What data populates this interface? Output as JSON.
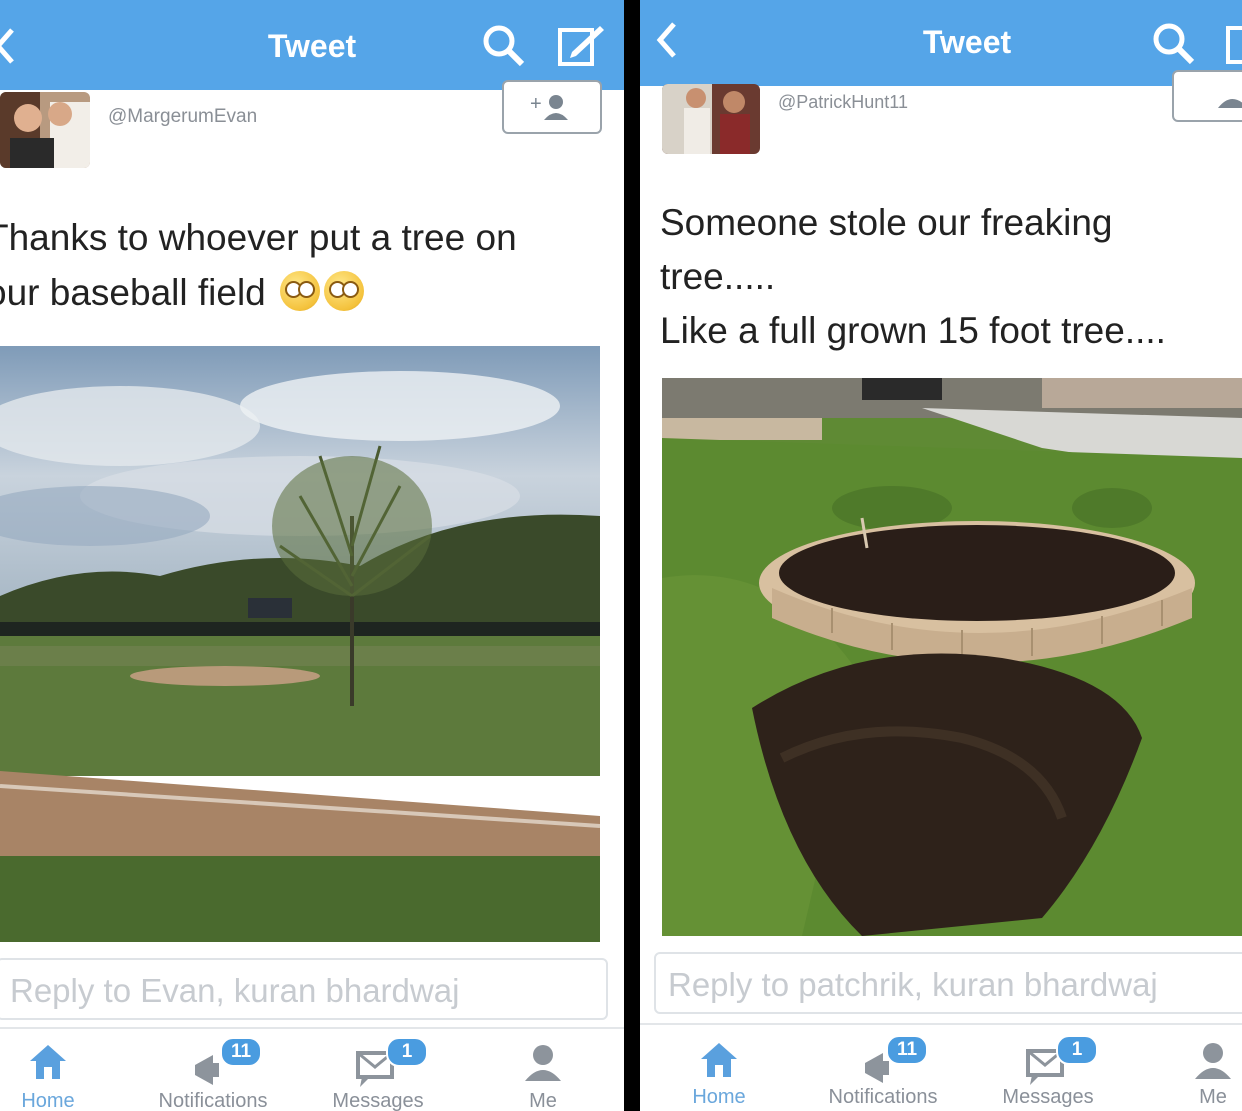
{
  "left": {
    "header": {
      "title": "Tweet"
    },
    "tweet": {
      "handle": "@MargerumEvan",
      "text_lines": [
        "Thanks to whoever put a tree on",
        "our baseball field"
      ]
    },
    "reply": {
      "placeholder": "Reply to Evan, kuran bhardwaj"
    },
    "tabbar": {
      "home": "Home",
      "notifications": "Notifications",
      "notifications_badge": "11",
      "messages": "Messages",
      "messages_badge": "1",
      "me": "Me"
    }
  },
  "right": {
    "header": {
      "title": "Tweet"
    },
    "tweet": {
      "handle": "@PatrickHunt11",
      "text_lines": [
        "Someone stole our freaking",
        "tree.....",
        "Like a full grown 15 foot tree...."
      ]
    },
    "reply": {
      "placeholder": "Reply to patchrik, kuran bhardwaj"
    },
    "tabbar": {
      "home": "Home",
      "notifications": "Notifications",
      "notifications_badge": "11",
      "messages": "Messages",
      "messages_badge": "1",
      "me": "Me"
    }
  },
  "colors": {
    "header_bar": "#55a5e8",
    "badge": "#4a9ce0",
    "divider": "#000000"
  },
  "icons": [
    "back-icon",
    "search-icon",
    "compose-icon",
    "follow-icon",
    "home-icon",
    "notifications-icon",
    "messages-icon",
    "me-icon",
    "flushed-face-emoji"
  ]
}
